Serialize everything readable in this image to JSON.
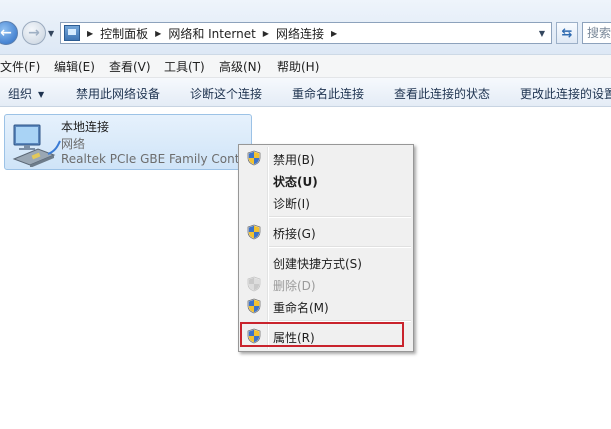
{
  "address_bar": {
    "breadcrumbs": [
      "控制面板",
      "网络和 Internet",
      "网络连接"
    ],
    "search_placeholder": "搜索"
  },
  "menu": [
    "文件(F)",
    "编辑(E)",
    "查看(V)",
    "工具(T)",
    "高级(N)",
    "帮助(H)"
  ],
  "commands": {
    "organize": "组织",
    "disable": "禁用此网络设备",
    "diagnose": "诊断这个连接",
    "rename": "重命名此连接",
    "view_status": "查看此连接的状态",
    "change_settings": "更改此连接的设置"
  },
  "connection": {
    "name": "本地连接",
    "status": "网络",
    "device": "Realtek PCIe GBE Family Controller"
  },
  "context_menu": {
    "disable": "禁用(B)",
    "status": "状态(U)",
    "diagnose": "诊断(I)",
    "bridge": "桥接(G)",
    "create_shortcut": "创建快捷方式(S)",
    "delete": "删除(D)",
    "rename": "重命名(M)",
    "properties": "属性(R)"
  },
  "colors": {
    "highlight_border": "#c9232c",
    "tile_background": "#d8eaf9"
  }
}
